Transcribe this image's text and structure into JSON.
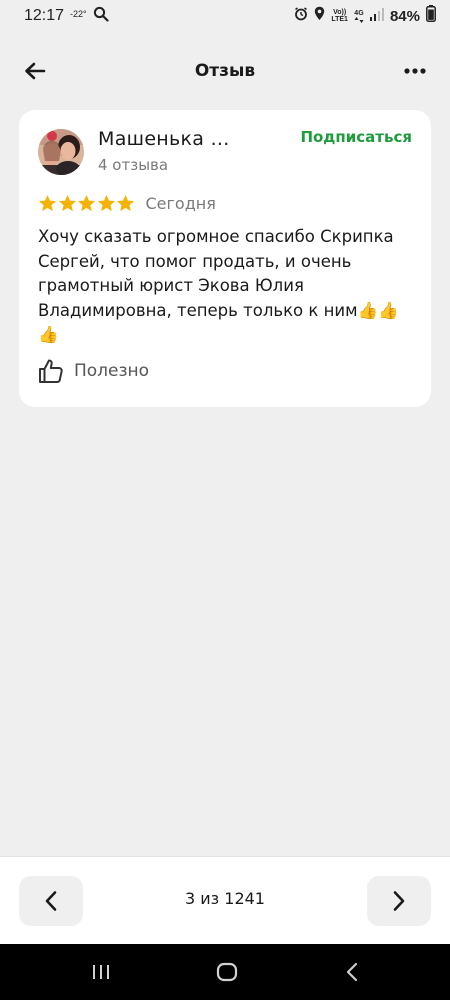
{
  "status_bar": {
    "time": "12:17",
    "temperature": "-22°",
    "network_top": "Vo))",
    "network_bottom": "LTE1",
    "network_type": "4G",
    "battery": "84%"
  },
  "header": {
    "title": "Отзыв"
  },
  "review": {
    "author_name": "Машенька ...",
    "author_reviews": "4 отзыва",
    "subscribe_label": "Подписаться",
    "rating": 5,
    "rating_max": 5,
    "date": "Сегодня",
    "text": "Хочу сказать огромное спасибо Скрипка Сергей, что помог продать, и очень грамотный юрист Экова Юлия Владимировна, теперь только к ним👍👍👍",
    "useful_label": "Полезно"
  },
  "pagination": {
    "counter": "3 из 1241"
  },
  "colors": {
    "accent_green": "#1f9c3c",
    "star_yellow": "#f5b301",
    "background": "#efefef",
    "card": "#ffffff"
  },
  "icons": {
    "back": "arrow-left-icon",
    "more": "more-horizontal-icon",
    "star": "star-icon",
    "like": "thumbs-up-icon",
    "prev": "chevron-left-icon",
    "next": "chevron-right-icon"
  }
}
